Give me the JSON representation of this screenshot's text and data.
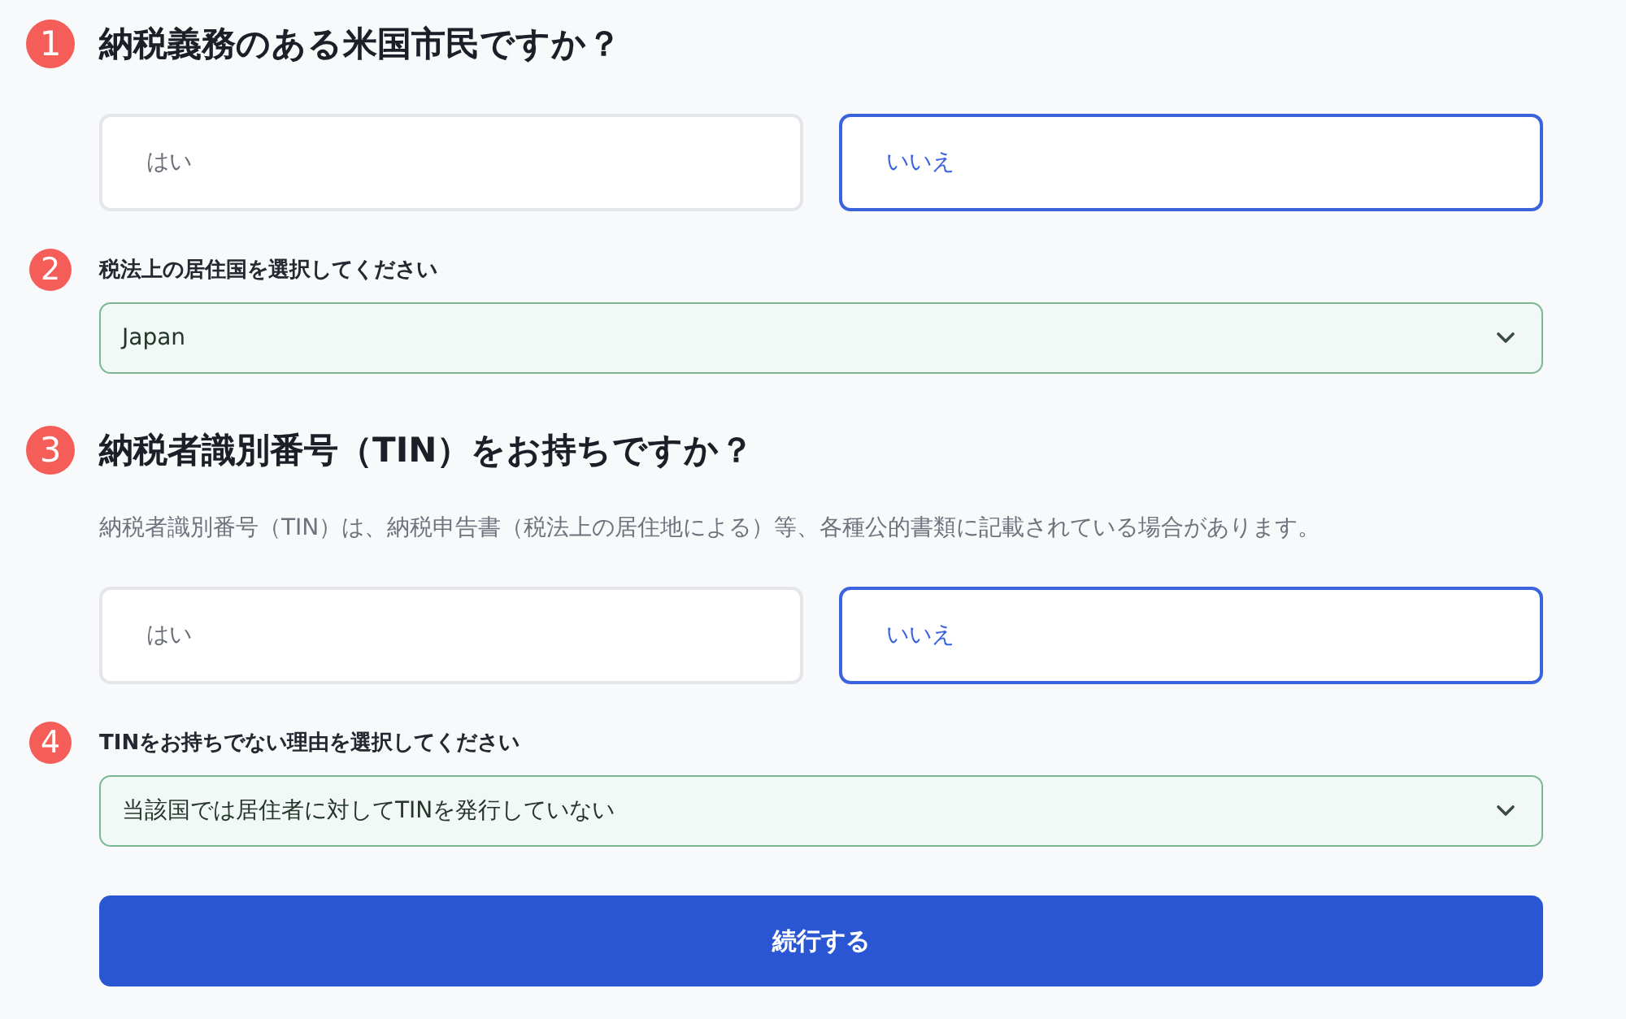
{
  "steps": [
    {
      "kind": "question",
      "number": "1",
      "heading": "納税義務のある米国市民ですか？",
      "options": [
        {
          "label": "はい",
          "selected": false
        },
        {
          "label": "いいえ",
          "selected": true
        }
      ]
    },
    {
      "kind": "select",
      "number": "2",
      "label": "税法上の居住国を選択してください",
      "value": "Japan"
    },
    {
      "kind": "question",
      "number": "3",
      "heading": "納税者識別番号（TIN）をお持ちですか？",
      "note": "納税者識別番号（TIN）は、納税申告書（税法上の居住地による）等、各種公的書類に記載されている場合があります。",
      "options": [
        {
          "label": "はい",
          "selected": false
        },
        {
          "label": "いいえ",
          "selected": true
        }
      ]
    },
    {
      "kind": "select",
      "number": "4",
      "label": "TINをお持ちでない理由を選択してください",
      "value": "当該国では居住者に対してTINを発行していない"
    }
  ],
  "submit": {
    "label": "続行する"
  }
}
